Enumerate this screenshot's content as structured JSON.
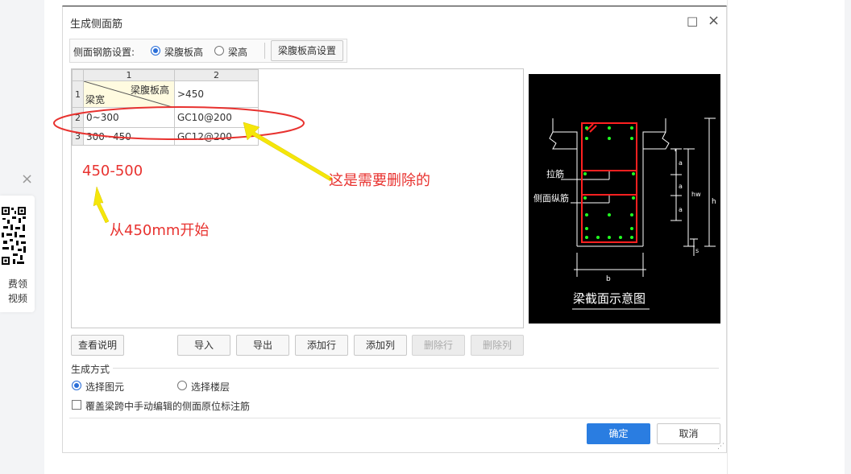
{
  "dialog": {
    "title": "生成侧面筋",
    "maximize": "□",
    "close": "×"
  },
  "settings": {
    "label": "侧面钢筋设置:",
    "option_web_height": "梁腹板高",
    "option_beam_height": "梁高",
    "web_height_button": "梁腹板高设置",
    "selected": "梁腹板高"
  },
  "table": {
    "col_headers": [
      "1",
      "2"
    ],
    "row_headers": [
      "1",
      "2",
      "3"
    ],
    "corner_top": "梁腹板高",
    "corner_bottom": "梁宽",
    "header_value": ">450",
    "rows": [
      {
        "width": "0~300",
        "value": "GC10@200"
      },
      {
        "width": "300~450",
        "value": "GC12@200"
      }
    ]
  },
  "schema": {
    "label_tie": "拉筋",
    "label_side": "侧面纵筋",
    "label_a1": "a",
    "label_a2": "a",
    "label_a3": "a",
    "label_hw": "hw",
    "label_h": "h",
    "label_s": "s",
    "label_b": "b",
    "caption": "梁截面示意图"
  },
  "buttons": {
    "view_help": "查看说明",
    "import": "导入",
    "export": "导出",
    "add_row": "添加行",
    "add_col": "添加列",
    "delete_row": "删除行",
    "delete_col": "删除列",
    "ok": "确定",
    "cancel": "取消"
  },
  "generate": {
    "section": "生成方式",
    "option_element": "选择图元",
    "option_floor": "选择楼层",
    "selected": "选择图元",
    "override_label": "覆盖梁跨中手动编辑的侧面原位标注筋",
    "override_checked": false
  },
  "annotations": {
    "delete_note": "这是需要删除的",
    "range": "450-500",
    "start_note": "从450mm开始"
  },
  "sidebar_widget": {
    "close": "×",
    "line1": "费领",
    "line2": "视频"
  },
  "colors": {
    "annotation_red": "#e8322f",
    "arrow_yellow": "#f5e60a",
    "primary_blue": "#2a7de1",
    "rebar_red": "#ff2020",
    "rebar_green": "#20ff20"
  }
}
